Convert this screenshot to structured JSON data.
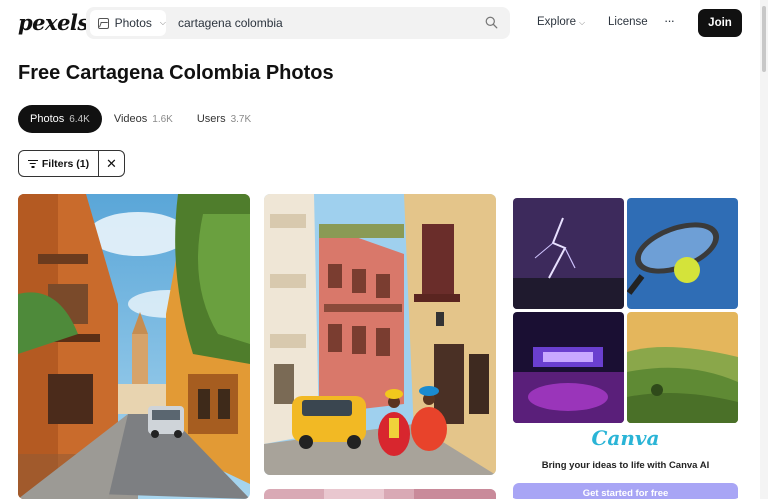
{
  "header": {
    "logo": "pexels",
    "search_type": "Photos",
    "search_value": "cartagena colombia",
    "nav_explore": "Explore",
    "nav_license": "License",
    "nav_more": "···",
    "join_label": "Join"
  },
  "page_title": "Free Cartagena Colombia Photos",
  "tabs": [
    {
      "label": "Photos",
      "count": "6.4K",
      "active": true
    },
    {
      "label": "Videos",
      "count": "1.6K",
      "active": false
    },
    {
      "label": "Users",
      "count": "3.7K",
      "active": false
    }
  ],
  "filters": {
    "label": "Filters (1)",
    "clear": "✕"
  },
  "ad": {
    "brand": "Canva",
    "text": "Bring your ideas to life with Canva AI",
    "cta": "Get started for free"
  },
  "colors": {
    "accent": "#111111",
    "canva_brand": "#2ab4d6",
    "cta_bg": "#a8a5f5"
  }
}
